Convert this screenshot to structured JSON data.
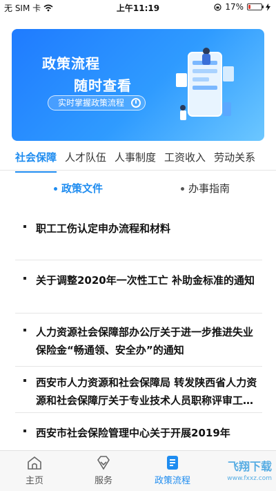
{
  "status_bar": {
    "carrier": "无 SIM 卡",
    "time": "上午11:19",
    "battery": "17%"
  },
  "banner": {
    "title_line1": "政策流程",
    "title_line2": "随时查看",
    "pill_text": "实时掌握政策流程"
  },
  "tabs": [
    {
      "label": "社会保障",
      "active": true
    },
    {
      "label": "人才队伍"
    },
    {
      "label": "人事制度"
    },
    {
      "label": "工资收入"
    },
    {
      "label": "劳动关系"
    }
  ],
  "subtabs": {
    "policy_docs": "政策文件",
    "guide": "办事指南"
  },
  "articles": [
    {
      "title": "职工工伤认定申办流程和材料"
    },
    {
      "title": "关于调整2020年一次性工亡 补助金标准的通知"
    },
    {
      "title": "人力资源社会保障部办公厅关于进一步推进失业保险金“畅通领、安全办”的通知"
    },
    {
      "title": "西安市人力资源和社会保障局 转发陕西省人力资源和社会保障厅关于专业技术人员职称评审工作的通知"
    },
    {
      "title": "西安市社会保险管理中心关于开展2019年"
    }
  ],
  "bottom_nav": {
    "home": "主页",
    "service": "服务",
    "policy": "政策流程"
  },
  "watermark": {
    "brand": "飞翔下载",
    "url": "www.fxxz.com"
  },
  "colors": {
    "accent": "#1e8cf0",
    "banner_start": "#1f7bff",
    "banner_end": "#6cc7ff",
    "battery_low": "#e03a2f"
  }
}
